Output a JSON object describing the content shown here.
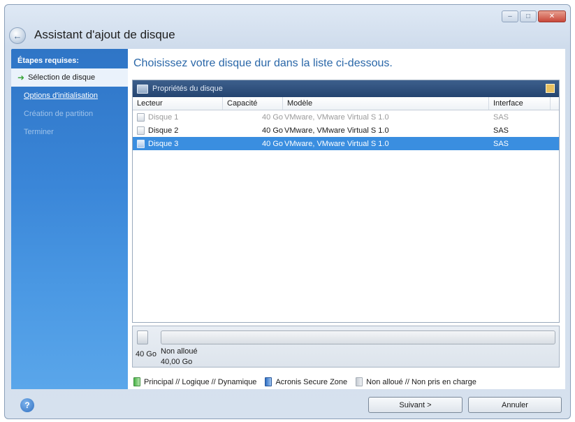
{
  "window": {
    "title": "Assistant d'ajout de disque",
    "controls": {
      "minimize_icon": "minimize-icon",
      "maximize_icon": "maximize-icon",
      "close_icon": "close-icon"
    }
  },
  "sidebar": {
    "heading": "Étapes requises:",
    "items": [
      {
        "label": "Sélection de disque",
        "state": "active",
        "icon": "arrow-right-icon"
      },
      {
        "label": "Options d'initialisation",
        "state": "link"
      },
      {
        "label": "Création de partition",
        "state": "disabled"
      },
      {
        "label": "Terminer",
        "state": "disabled"
      }
    ]
  },
  "main": {
    "headline": "Choisissez votre disque dur dans la liste ci-dessous.",
    "toolbar_label": "Propriétés du disque",
    "columns": [
      "Lecteur",
      "Capacité",
      "Modèle",
      "Interface"
    ],
    "rows": [
      {
        "drive": "Disque 1",
        "capacity": "40 Go",
        "model": "VMware, VMware Virtual S 1.0",
        "interface": "SAS",
        "state": "disabled"
      },
      {
        "drive": "Disque 2",
        "capacity": "40 Go",
        "model": "VMware, VMware Virtual S 1.0",
        "interface": "SAS",
        "state": "normal"
      },
      {
        "drive": "Disque 3",
        "capacity": "40 Go",
        "model": "VMware, VMware Virtual S 1.0",
        "interface": "SAS",
        "state": "selected"
      }
    ],
    "disk_map": {
      "size": "40 Go",
      "label_line1": "Non alloué",
      "label_line2": "40,00 Go"
    },
    "legend": [
      {
        "label": "Principal // Logique // Dynamique",
        "color": "#49b349"
      },
      {
        "label": "Acronis Secure Zone",
        "color": "#2e6fc4"
      },
      {
        "label": "Non alloué // Non pris en charge",
        "color": "#c6ccd3"
      }
    ]
  },
  "footer": {
    "next_label": "Suivant >",
    "cancel_label": "Annuler"
  },
  "colors": {
    "sidebar": "#3a86d8",
    "selection": "#3a8ee0",
    "headline": "#2a67a8",
    "toolbar": "#254470"
  }
}
